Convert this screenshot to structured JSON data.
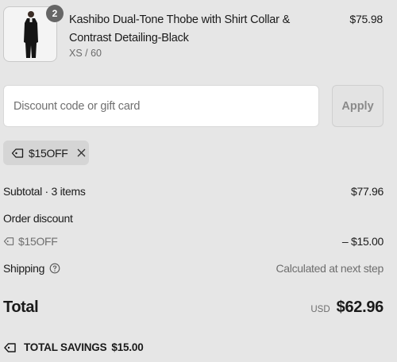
{
  "product": {
    "quantity": "2",
    "name": "Kashibo Dual-Tone Thobe with Shirt Collar & Contrast Detailing-Black",
    "variant": "XS / 60",
    "price": "$75.98",
    "image_icon": "thobe-image"
  },
  "discount": {
    "placeholder": "Discount code or gift card",
    "value": "",
    "apply_label": "Apply",
    "applied_code": "$15OFF",
    "tag_icon": "tag-icon",
    "remove_icon": "close-icon"
  },
  "summary": {
    "subtotal_label": "Subtotal · 3 items",
    "subtotal_value": "$77.96",
    "order_discount_label": "Order discount",
    "discount_code": "$15OFF",
    "discount_value": "– $15.00",
    "shipping_label": "Shipping",
    "shipping_value": "Calculated at next step",
    "total_label": "Total",
    "currency": "USD",
    "total_value": "$62.96",
    "savings_label": "TOTAL SAVINGS",
    "savings_value": "$15.00"
  },
  "colors": {
    "background": "#e6e6e6",
    "badge": "#666666",
    "chip": "#d5d5d5"
  }
}
